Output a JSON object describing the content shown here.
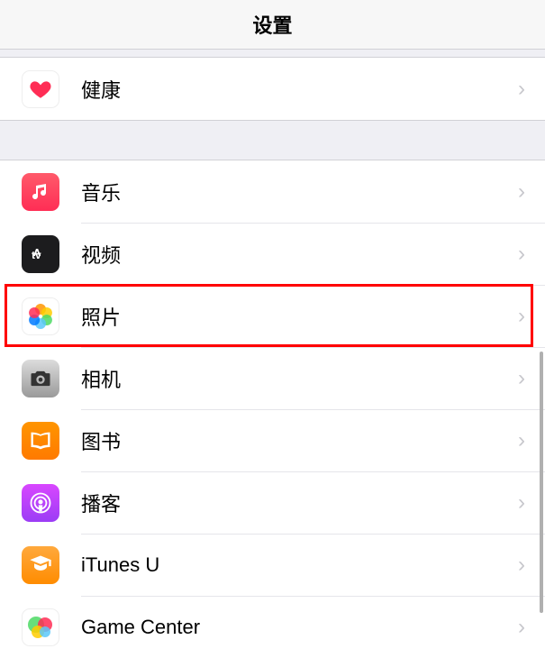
{
  "header": {
    "title": "设置"
  },
  "group1": {
    "items": [
      {
        "id": "health",
        "label": "健康"
      }
    ]
  },
  "group2": {
    "items": [
      {
        "id": "music",
        "label": "音乐"
      },
      {
        "id": "video",
        "label": "视频"
      },
      {
        "id": "photos",
        "label": "照片"
      },
      {
        "id": "camera",
        "label": "相机"
      },
      {
        "id": "books",
        "label": "图书"
      },
      {
        "id": "podcasts",
        "label": "播客"
      },
      {
        "id": "itunesu",
        "label": "iTunes U"
      },
      {
        "id": "gamecenter",
        "label": "Game Center"
      }
    ]
  },
  "highlight": {
    "target": "photos"
  }
}
